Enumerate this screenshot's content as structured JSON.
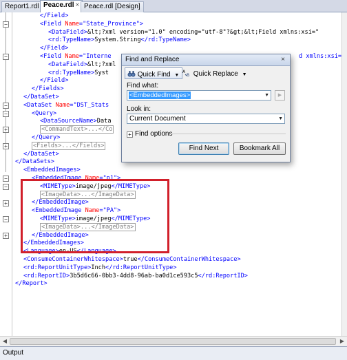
{
  "tabs": [
    {
      "label": "Report1.rdl",
      "active": false
    },
    {
      "label": "Peace.rdl",
      "active": true,
      "close": "×"
    },
    {
      "label": "Peace.rdl [Design]",
      "active": false
    }
  ],
  "code": {
    "l1": "</Field>",
    "l2a": "<Field ",
    "l2b": "Name",
    "l2c": "=\"State_Province\">",
    "l3a": "<DataField>",
    "l3b": "&lt;?xml version=\"1.0\" encoding=\"utf-8\"?&gt;&lt;Field xmlns:xsi=\"",
    "l4a": "<rd:TypeName>",
    "l4b": "System.String",
    "l4c": "</rd:TypeName>",
    "l5": "</Field>",
    "l6a": "<Field ",
    "l6b": "Name",
    "l6c": "=\"Interne",
    "l6tail": "d xmlns:xsi=\"",
    "l7a": "<DataField>",
    "l7b": "&lt;?xml",
    "l8a": "<rd:TypeName>",
    "l8b": "Syst",
    "l9": "</Field>",
    "l10": "</Fields>",
    "l11": "</DataSet>",
    "l12a": "<DataSet ",
    "l12b": "Name",
    "l12c": "=\"DST_Stats",
    "l13": "<Query>",
    "l14a": "<DataSourceName>",
    "l14b": "Data",
    "l15": "<CommandText>...</Co",
    "l16": "</Query>",
    "l17": "<Fields>...</Fields>",
    "l18": "</DataSet>",
    "l19": "</DataSets>",
    "l20": "<EmbeddedImages>",
    "l21a": "<EmbeddedImage ",
    "l21b": "Name",
    "l21c": "=\"p1\">",
    "l22a": "<MIMEType>",
    "l22b": "image/jpeg",
    "l22c": "</MIMEType>",
    "l23": "<ImageData>...</ImageData>",
    "l24": "</EmbeddedImage>",
    "l25a": "<EmbeddedImage ",
    "l25b": "Name",
    "l25c": "=\"PA\">",
    "l26a": "<MIMEType>",
    "l26b": "image/jpeg",
    "l26c": "</MIMEType>",
    "l27": "<ImageData>...</ImageData>",
    "l28": "</EmbeddedImage>",
    "l29": "</EmbeddedImages>",
    "l30a": "<Language>",
    "l30b": "en-US",
    "l30c": "</Language>",
    "l31a": "<ConsumeContainerWhitespace>",
    "l31b": "true",
    "l31c": "</ConsumeContainerWhitespace>",
    "l32a": "<rd:ReportUnitType>",
    "l32b": "Inch",
    "l32c": "</rd:ReportUnitType>",
    "l33a": "<rd:ReportID>",
    "l33b": "3b5d6c66-0bb3-4dd8-96ab-ba0d1ce593c5",
    "l33c": "</rd:ReportID>",
    "l34": "</Report>"
  },
  "dialog": {
    "title": "Find and Replace",
    "close": "×",
    "quick_find": "Quick Find",
    "quick_replace": "Quick Replace",
    "find_what_label": "Find what:",
    "find_what_value": "<EmbeddedImages>",
    "look_in_label": "Look in:",
    "look_in_value": "Current Document",
    "find_options": "Find options",
    "find_next": "Find Next",
    "bookmark_all": "Bookmark All"
  },
  "output_label": "Output",
  "colors": {
    "highlight": "#d11f2a",
    "selection": "#3399ff"
  }
}
